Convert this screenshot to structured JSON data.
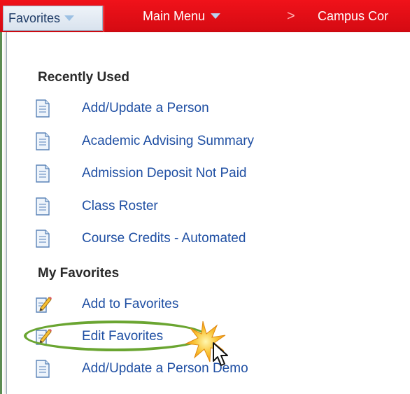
{
  "navbar": {
    "favorites_label": "Favorites",
    "main_menu_label": "Main Menu",
    "separator": ">",
    "breadcrumb_label": "Campus Cor"
  },
  "recently_used": {
    "title": "Recently Used",
    "items": [
      {
        "label": "Add/Update a Person",
        "icon": "document-icon"
      },
      {
        "label": "Academic Advising Summary",
        "icon": "document-icon"
      },
      {
        "label": "Admission Deposit Not Paid",
        "icon": "document-icon"
      },
      {
        "label": "Class Roster",
        "icon": "document-icon"
      },
      {
        "label": "Course Credits - Automated",
        "icon": "document-icon"
      }
    ]
  },
  "my_favorites": {
    "title": "My Favorites",
    "items": [
      {
        "label": "Add to Favorites",
        "icon": "edit-pencil-icon"
      },
      {
        "label": "Edit Favorites",
        "icon": "edit-pencil-icon"
      },
      {
        "label": "Add/Update a Person Demo",
        "icon": "document-icon"
      }
    ]
  },
  "colors": {
    "nav_red": "#e6101a",
    "link_blue": "#1f4fa3",
    "highlight_green": "#6aa531",
    "burst_orange": "#f7a21b"
  }
}
